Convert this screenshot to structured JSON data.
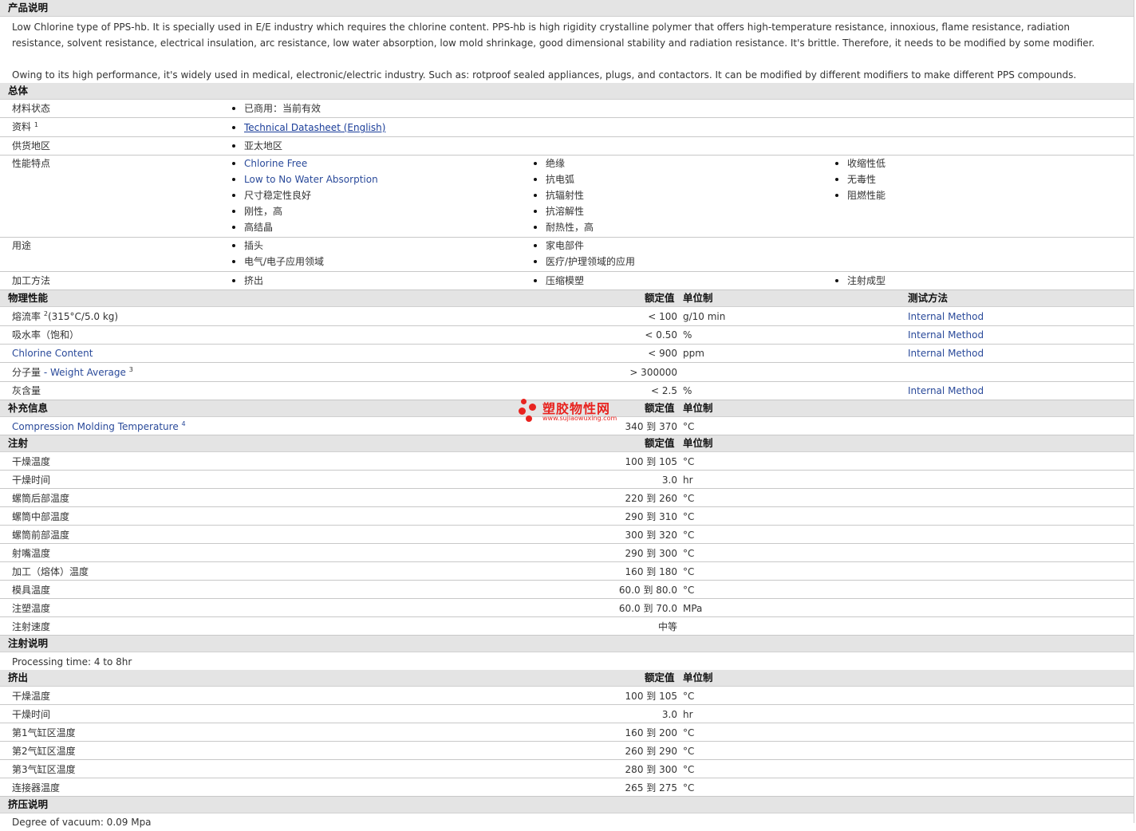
{
  "description": {
    "title": "产品说明",
    "p1": "Low Chlorine type of PPS-hb. It is specially used in E/E industry which requires the chlorine content. PPS-hb is high rigidity crystalline polymer that offers high-temperature resistance, innoxious, flame resistance, radiation resistance, solvent resistance, electrical insulation, arc resistance, low water absorption, low mold shrinkage, good dimensional stability and radiation resistance. It's brittle. Therefore, it needs to be modified by some modifier.",
    "p2": "Owing to its high performance, it's widely used in medical, electronic/electric industry. Such as: rotproof sealed appliances, plugs, and contactors. It can be modified by different modifiers to make different PPS compounds."
  },
  "general": {
    "title": "总体",
    "status_label": "材料状态",
    "status_value": "已商用：当前有效",
    "docs_label": "资料",
    "docs_sup": "1",
    "docs_link": "Technical Datasheet (English)",
    "supply_label": "供货地区",
    "supply_value": "亚太地区",
    "features_label": "性能特点",
    "features_col1": [
      "Chlorine Free",
      "Low to No Water Absorption",
      "尺寸稳定性良好",
      "刚性，高",
      "高结晶"
    ],
    "features_col2": [
      "绝缘",
      "抗电弧",
      "抗辐射性",
      "抗溶解性",
      "耐热性，高"
    ],
    "features_col3": [
      "收缩性低",
      "无毒性",
      "阻燃性能"
    ],
    "uses_label": "用途",
    "uses_col1": [
      "插头",
      "电气/电子应用领域"
    ],
    "uses_col2": [
      "家电部件",
      "医疗/护理领域的应用"
    ],
    "process_label": "加工方法",
    "process_col1": [
      "挤出"
    ],
    "process_col2": [
      "压缩模塑"
    ],
    "process_col3": [
      "注射成型"
    ]
  },
  "physical": {
    "title": "物理性能",
    "h_value": "额定值",
    "h_unit": "单位制",
    "h_test": "测试方法",
    "mfr_label": "熔流率",
    "mfr_sup": "2",
    "mfr_cond": "(315°C/5.0 kg)",
    "mfr_value": "< 100",
    "mfr_unit": "g/10 min",
    "mfr_test": "Internal Method",
    "wa_label": "吸水率（饱和）",
    "wa_value": "< 0.50",
    "wa_unit": "%",
    "wa_test": "Internal Method",
    "cl_label": "Chlorine Content",
    "cl_value": "< 900",
    "cl_unit": "ppm",
    "cl_test": "Internal Method",
    "mw_label": "分子量",
    "mw_sub": "- Weight Average",
    "mw_sup": "3",
    "mw_value": "> 300000",
    "ash_label": "灰含量",
    "ash_value": "< 2.5",
    "ash_unit": "%",
    "ash_test": "Internal Method"
  },
  "supplement": {
    "title": "补充信息",
    "h_value": "额定值",
    "h_unit": "单位制",
    "cmt_label": "Compression Molding Temperature",
    "cmt_sup": "4",
    "cmt_value": "340 到 370",
    "cmt_unit": "°C"
  },
  "watermark": {
    "text": "塑胶物性网",
    "url": "www.sujiaowuxing.com"
  },
  "injection": {
    "title": "注射",
    "h_value": "额定值",
    "h_unit": "单位制",
    "rows": [
      {
        "label": "干燥温度",
        "value": "100 到 105",
        "unit": "°C"
      },
      {
        "label": "干燥时间",
        "value": "3.0",
        "unit": "hr"
      },
      {
        "label": "螺筒后部温度",
        "value": "220 到 260",
        "unit": "°C"
      },
      {
        "label": "螺筒中部温度",
        "value": "290 到 310",
        "unit": "°C"
      },
      {
        "label": "螺筒前部温度",
        "value": "300 到 320",
        "unit": "°C"
      },
      {
        "label": "射嘴温度",
        "value": "290 到 300",
        "unit": "°C"
      },
      {
        "label": "加工（熔体）温度",
        "value": "160 到 180",
        "unit": "°C"
      },
      {
        "label": "模具温度",
        "value": "60.0 到 80.0",
        "unit": "°C"
      },
      {
        "label": "注塑温度",
        "value": "60.0 到 70.0",
        "unit": "MPa"
      },
      {
        "label": "注射速度",
        "value": "中等",
        "unit": ""
      }
    ]
  },
  "injection_note": {
    "title": "注射说明",
    "text": "Processing time: 4 to 8hr"
  },
  "extrusion": {
    "title": "挤出",
    "h_value": "额定值",
    "h_unit": "单位制",
    "rows": [
      {
        "label": "干燥温度",
        "value": "100 到 105",
        "unit": "°C"
      },
      {
        "label": "干燥时间",
        "value": "3.0",
        "unit": "hr"
      },
      {
        "label": "第1气缸区温度",
        "value": "160 到 200",
        "unit": "°C"
      },
      {
        "label": "第2气缸区温度",
        "value": "260 到 290",
        "unit": "°C"
      },
      {
        "label": "第3气缸区温度",
        "value": "280 到 300",
        "unit": "°C"
      },
      {
        "label": "连接器温度",
        "value": "265 到 275",
        "unit": "°C"
      }
    ]
  },
  "extrusion_note": {
    "title": "挤压说明",
    "text": "Degree of vacuum: 0.09 Mpa"
  }
}
